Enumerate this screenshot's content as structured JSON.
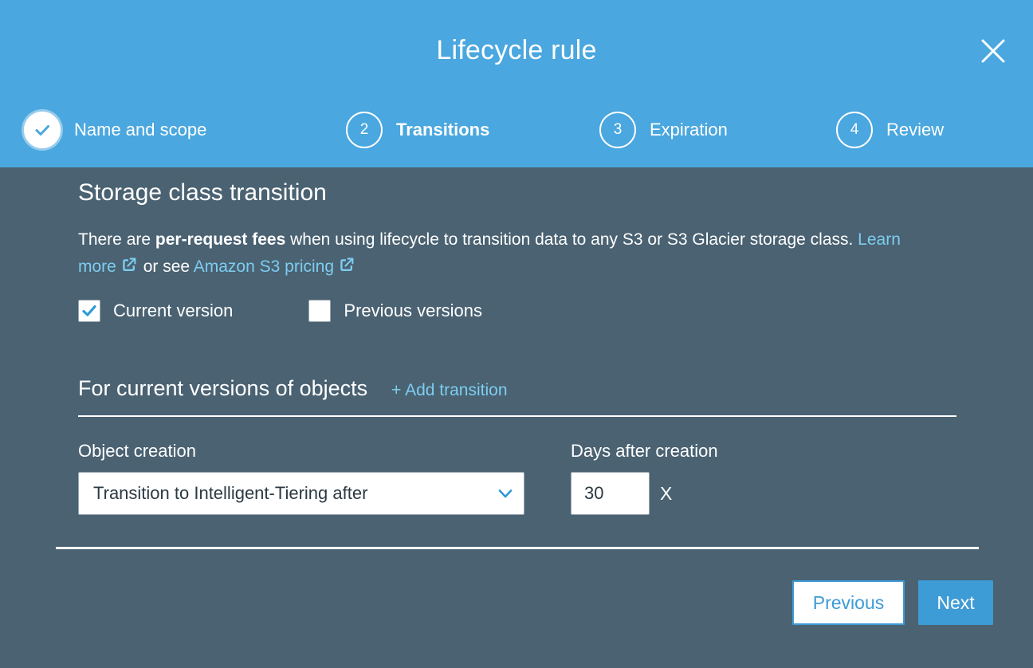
{
  "header": {
    "title": "Lifecycle rule",
    "close_icon": "close-icon",
    "accent_color": "#4aa7df",
    "steps": [
      {
        "number": "1",
        "label": "Name and scope",
        "state": "completed",
        "icon": "check-icon"
      },
      {
        "number": "2",
        "label": "Transitions",
        "state": "current"
      },
      {
        "number": "3",
        "label": "Expiration",
        "state": "upcoming"
      },
      {
        "number": "4",
        "label": "Review",
        "state": "upcoming"
      }
    ]
  },
  "body": {
    "background_color": "#4a6272",
    "section_title": "Storage class transition",
    "intro": {
      "part1": "There are ",
      "bold": "per-request fees",
      "part2": " when using lifecycle to transition data to any S3 or S3 Glacier storage class. ",
      "link1": "Learn more",
      "between": " or see ",
      "link2": "Amazon S3 pricing",
      "link_color": "#7dcdf0",
      "external_link_icon": "external-link-icon"
    },
    "version_checkboxes": [
      {
        "label": "Current version",
        "checked": true
      },
      {
        "label": "Previous versions",
        "checked": false
      }
    ],
    "subsection": {
      "title": "For current versions of objects",
      "add_transition": "+ Add transition"
    },
    "form": {
      "object_creation_label": "Object creation",
      "object_creation_value": "Transition to Intelligent-Tiering after",
      "days_label": "Days after creation",
      "days_value": "30",
      "days_placeholder": "30",
      "remove_label": "X",
      "caret_icon": "chevron-down-icon"
    }
  },
  "footer": {
    "previous_label": "Previous",
    "next_label": "Next",
    "primary_color": "#3d9bd6"
  }
}
